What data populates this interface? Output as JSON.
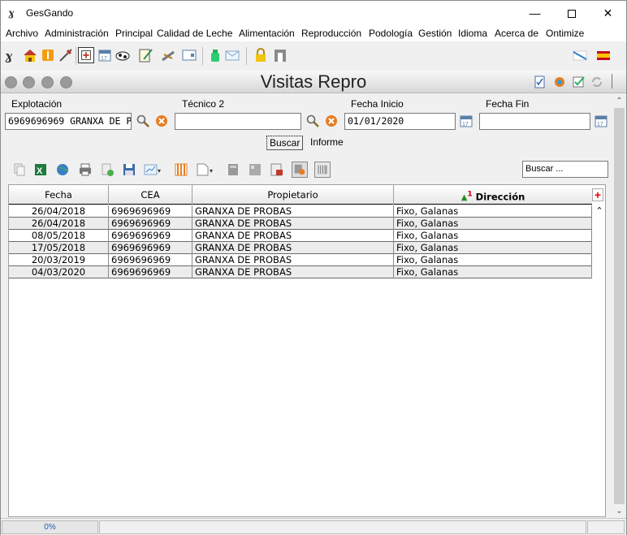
{
  "window": {
    "title": "GesGando",
    "min_label": "—",
    "close_label": "✕"
  },
  "menu": [
    "Archivo",
    "Administración",
    "Principal",
    "Calidad de Leche",
    "Alimentación",
    "Reproducción",
    "Podología",
    "Gestión",
    "Idioma",
    "Acerca de",
    "Ontimize"
  ],
  "page": {
    "title": "Visitas Repro"
  },
  "filters": {
    "explotacion_label": "Explotación",
    "explotacion_value": "6969696969 GRANXA DE P",
    "tecnico_label": "Técnico 2",
    "tecnico_value": "",
    "fecha_inicio_label": "Fecha Inicio",
    "fecha_inicio_value": "01/01/2020",
    "fecha_fin_label": "Fecha Fin",
    "fecha_fin_value": ""
  },
  "actions": {
    "buscar": "Buscar",
    "informe": "Informe"
  },
  "grid_search": {
    "placeholder": "Buscar ..."
  },
  "table": {
    "columns": [
      "Fecha",
      "CEA",
      "Propietario",
      "Dirección"
    ],
    "sorted_column": "Dirección",
    "sort_order": "1",
    "add_column_label": "+",
    "rows": [
      [
        "26/04/2018",
        "6969696969",
        "GRANXA DE PROBAS",
        "Fixo, Galanas"
      ],
      [
        "26/04/2018",
        "6969696969",
        "GRANXA DE PROBAS",
        "Fixo, Galanas"
      ],
      [
        "08/05/2018",
        "6969696969",
        "GRANXA DE PROBAS",
        "Fixo, Galanas"
      ],
      [
        "17/05/2018",
        "6969696969",
        "GRANXA DE PROBAS",
        "Fixo, Galanas"
      ],
      [
        "20/03/2019",
        "6969696969",
        "GRANXA DE PROBAS",
        "Fixo, Galanas"
      ],
      [
        "04/03/2020",
        "6969696969",
        "GRANXA DE PROBAS",
        "Fixo, Galanas"
      ]
    ]
  },
  "status": {
    "progress": "0%"
  }
}
